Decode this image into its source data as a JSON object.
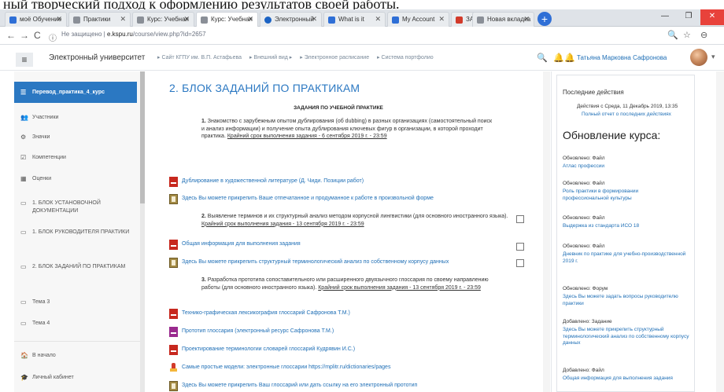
{
  "caption": "ный творческий подход к оформлению результатов своей работы.",
  "browser": {
    "tabs": [
      {
        "label": "моё Обучение",
        "color": "#2f6fd6"
      },
      {
        "label": "Практики",
        "color": "#8a8f97"
      },
      {
        "label": "Курс: Учебная",
        "color": "#8a8f97"
      },
      {
        "label": "Курс: Учебная",
        "color": "#8a8f97",
        "active": true
      },
      {
        "label": "Электронный",
        "color": "#1c63c4"
      },
      {
        "label": "What is it",
        "color": "#2f6fd6"
      },
      {
        "label": "My Account",
        "color": "#2f6fd6"
      },
      {
        "label": "ЗАПИСЬ",
        "color": "#d23a2a"
      },
      {
        "label": "Новая вкладка",
        "color": "#8a8f97"
      }
    ],
    "new_tab": "+",
    "window_controls": {
      "minimize": "—",
      "maximize": "❐",
      "close": "✕"
    },
    "nav": {
      "back": "←",
      "forward": "→",
      "reload": "C",
      "info": "ⓘ"
    },
    "url_prefix": "Не защищено |",
    "url_host": "e.kspu.ru",
    "url_path": "/course/view.php?id=2657",
    "icons": {
      "search": "🔍",
      "star": "☆",
      "account": "⊖"
    }
  },
  "topnav": {
    "menu": "≡",
    "site_name": "Электронный университет",
    "breadcrumbs": [
      "▸ Сайт КГПУ им. В.П. Астафьева",
      "▸ Внешний вид ▸",
      "▸ Электронное расписание",
      "▸ Система портфолио"
    ],
    "search": "🔍",
    "notifications": "🔔",
    "messages": "🔔",
    "user": "Татьяна Марковна Сафронова"
  },
  "sidebar": {
    "items": [
      {
        "icon": "☰",
        "label": "Перевод_практика_4_курс",
        "active": true
      },
      {
        "icon": "👥",
        "label": "Участники"
      },
      {
        "icon": "⚙",
        "label": "Значки"
      },
      {
        "icon": "☑",
        "label": "Компетенции"
      },
      {
        "icon": "▦",
        "label": "Оценки"
      },
      {
        "icon": "▭",
        "label": "1. БЛОК УСТАНОВОЧНОЙ ДОКУМЕНТАЦИИ"
      },
      {
        "icon": "▭",
        "label": "1. БЛОК РУКОВОДИТЕЛЯ ПРАКТИКИ"
      },
      {
        "icon": "▭",
        "label": "2. БЛОК ЗАДАНИЙ ПО ПРАКТИКАМ"
      },
      {
        "icon": "▭",
        "label": "Тема 3"
      },
      {
        "icon": "▭",
        "label": "Тема 4"
      },
      {
        "icon": "🏠",
        "label": "В начало"
      },
      {
        "icon": "🎓",
        "label": "Личный кабинет"
      }
    ]
  },
  "main": {
    "section_title": "2. БЛОК ЗАДАНИЙ ПО ПРАКТИКАМ",
    "subheading": "ЗАДАНИЯ ПО УЧЕБНОЙ ПРАКТИКЕ",
    "task1": {
      "num": "1.",
      "text": " Знакомство с зарубежным опытом дублирования (об dubbing) в разных организациях (самостоятельный поиск и анализ информации) и получение опыта дублирования ключевых фигур в организации, в которой проходит практика.",
      "deadline": "Крайний срок выполнения задания - 6 сентября 2019 г. - 23:59"
    },
    "res1": "Дублирование в художественной литературе (Д. Чиди. Позиции работ)",
    "res2": "Здесь Вы можете прикрепить Ваше отпечатанное и продуманное к работе в произвольной форме",
    "task2": {
      "num": "2.",
      "text": " Выявление терминов и их структурный анализ методом корпусной лингвистики (для основного иностранного языка).",
      "deadline": "Крайний срок выполнения задания - 13 сентября 2019 г. - 23:59"
    },
    "res3": "Общая информация для выполнения задания",
    "res4": "Здесь Вы можете прикрепить структурный терминологический анализ по собственному корпусу данных",
    "task3": {
      "num": "3.",
      "text": " Разработка прототипа сопоставительного или расширенного двуязычного глоссария по своему направлению работы (для основного иностранного языка).",
      "deadline": "Крайний срок выполнения задания - 13 сентября 2019 г. - 23:59"
    },
    "res5": "Технико-графическая лексикография глоссарий Сафронова Т.М.)",
    "res6": "Прототип глоссария (электронный ресурс Сафронова Т.М.)",
    "res7": "Проектирование терминологии словарей глоссарий Кудрявин И.С.)",
    "res8": "Самые простые модели: электронные глоссарии https://mplitr.ru/dictionaries/pages",
    "res9": "Здесь Вы можете прикрепить Ваш глоссарий или дать ссылку на его электронный прототип"
  },
  "right": {
    "recent_title": "Последние действия",
    "activity_since": "Действия с Среда, 11 Декабрь 2019, 13:35",
    "full_report": "Полный отчет о последних действиях",
    "course_updates": "Обновление курса:",
    "updates": [
      {
        "label": "Обновлено: Файл",
        "link": "Атлас профессии"
      },
      {
        "label": "Обновлено: Файл",
        "link": "Роль практики в формировании профессиональной культуры"
      },
      {
        "label": "Обновлено: Файл",
        "link": "Выдержка из стандарта ИСО 18"
      },
      {
        "label": "Обновлено: Файл",
        "link": "Дневник по практике для учебно-производственной 2019 г."
      },
      {
        "label": "Обновлено: Форум",
        "link": "Здесь Вы можете задать вопросы руководителю практики"
      },
      {
        "label": "Добавлено: Задание",
        "link": "Здесь Вы можете прикрепить структурный терминологический анализ по собственному корпусу данных"
      },
      {
        "label": "Добавлено: Файл",
        "link": "Общая информация для выполнения задания"
      }
    ]
  }
}
